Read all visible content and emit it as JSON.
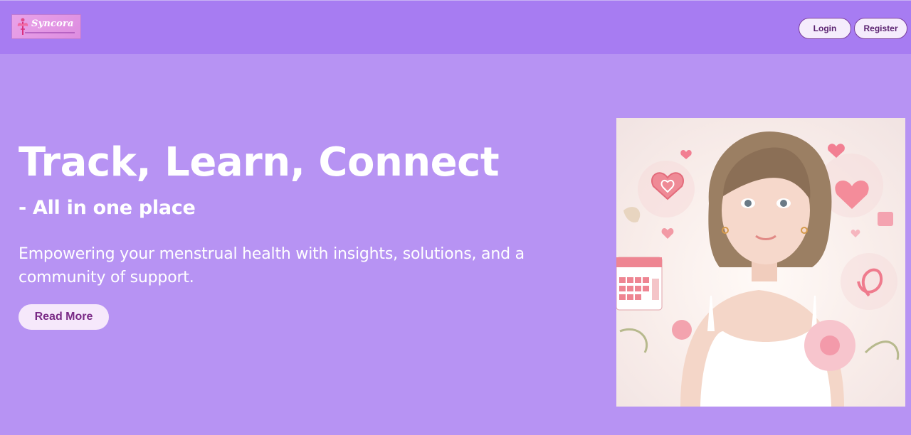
{
  "brand": {
    "name": "Syncora"
  },
  "nav": {
    "login_label": "Login",
    "register_label": "Register"
  },
  "hero": {
    "title": "Track, Learn, Connect",
    "subtitle": "- All in one place",
    "description": "Empowering your menstrual health with insights, solutions, and a community of support.",
    "cta_label": "Read More"
  },
  "colors": {
    "page_bg": "#b793f3",
    "navbar_bg": "#a77cf2",
    "button_bg": "#f5ecfc",
    "button_text": "#5a2270"
  },
  "icons": [
    "angel-logo-icon",
    "heart-icon",
    "calendar-icon",
    "flower-icon",
    "ribbon-icon"
  ]
}
